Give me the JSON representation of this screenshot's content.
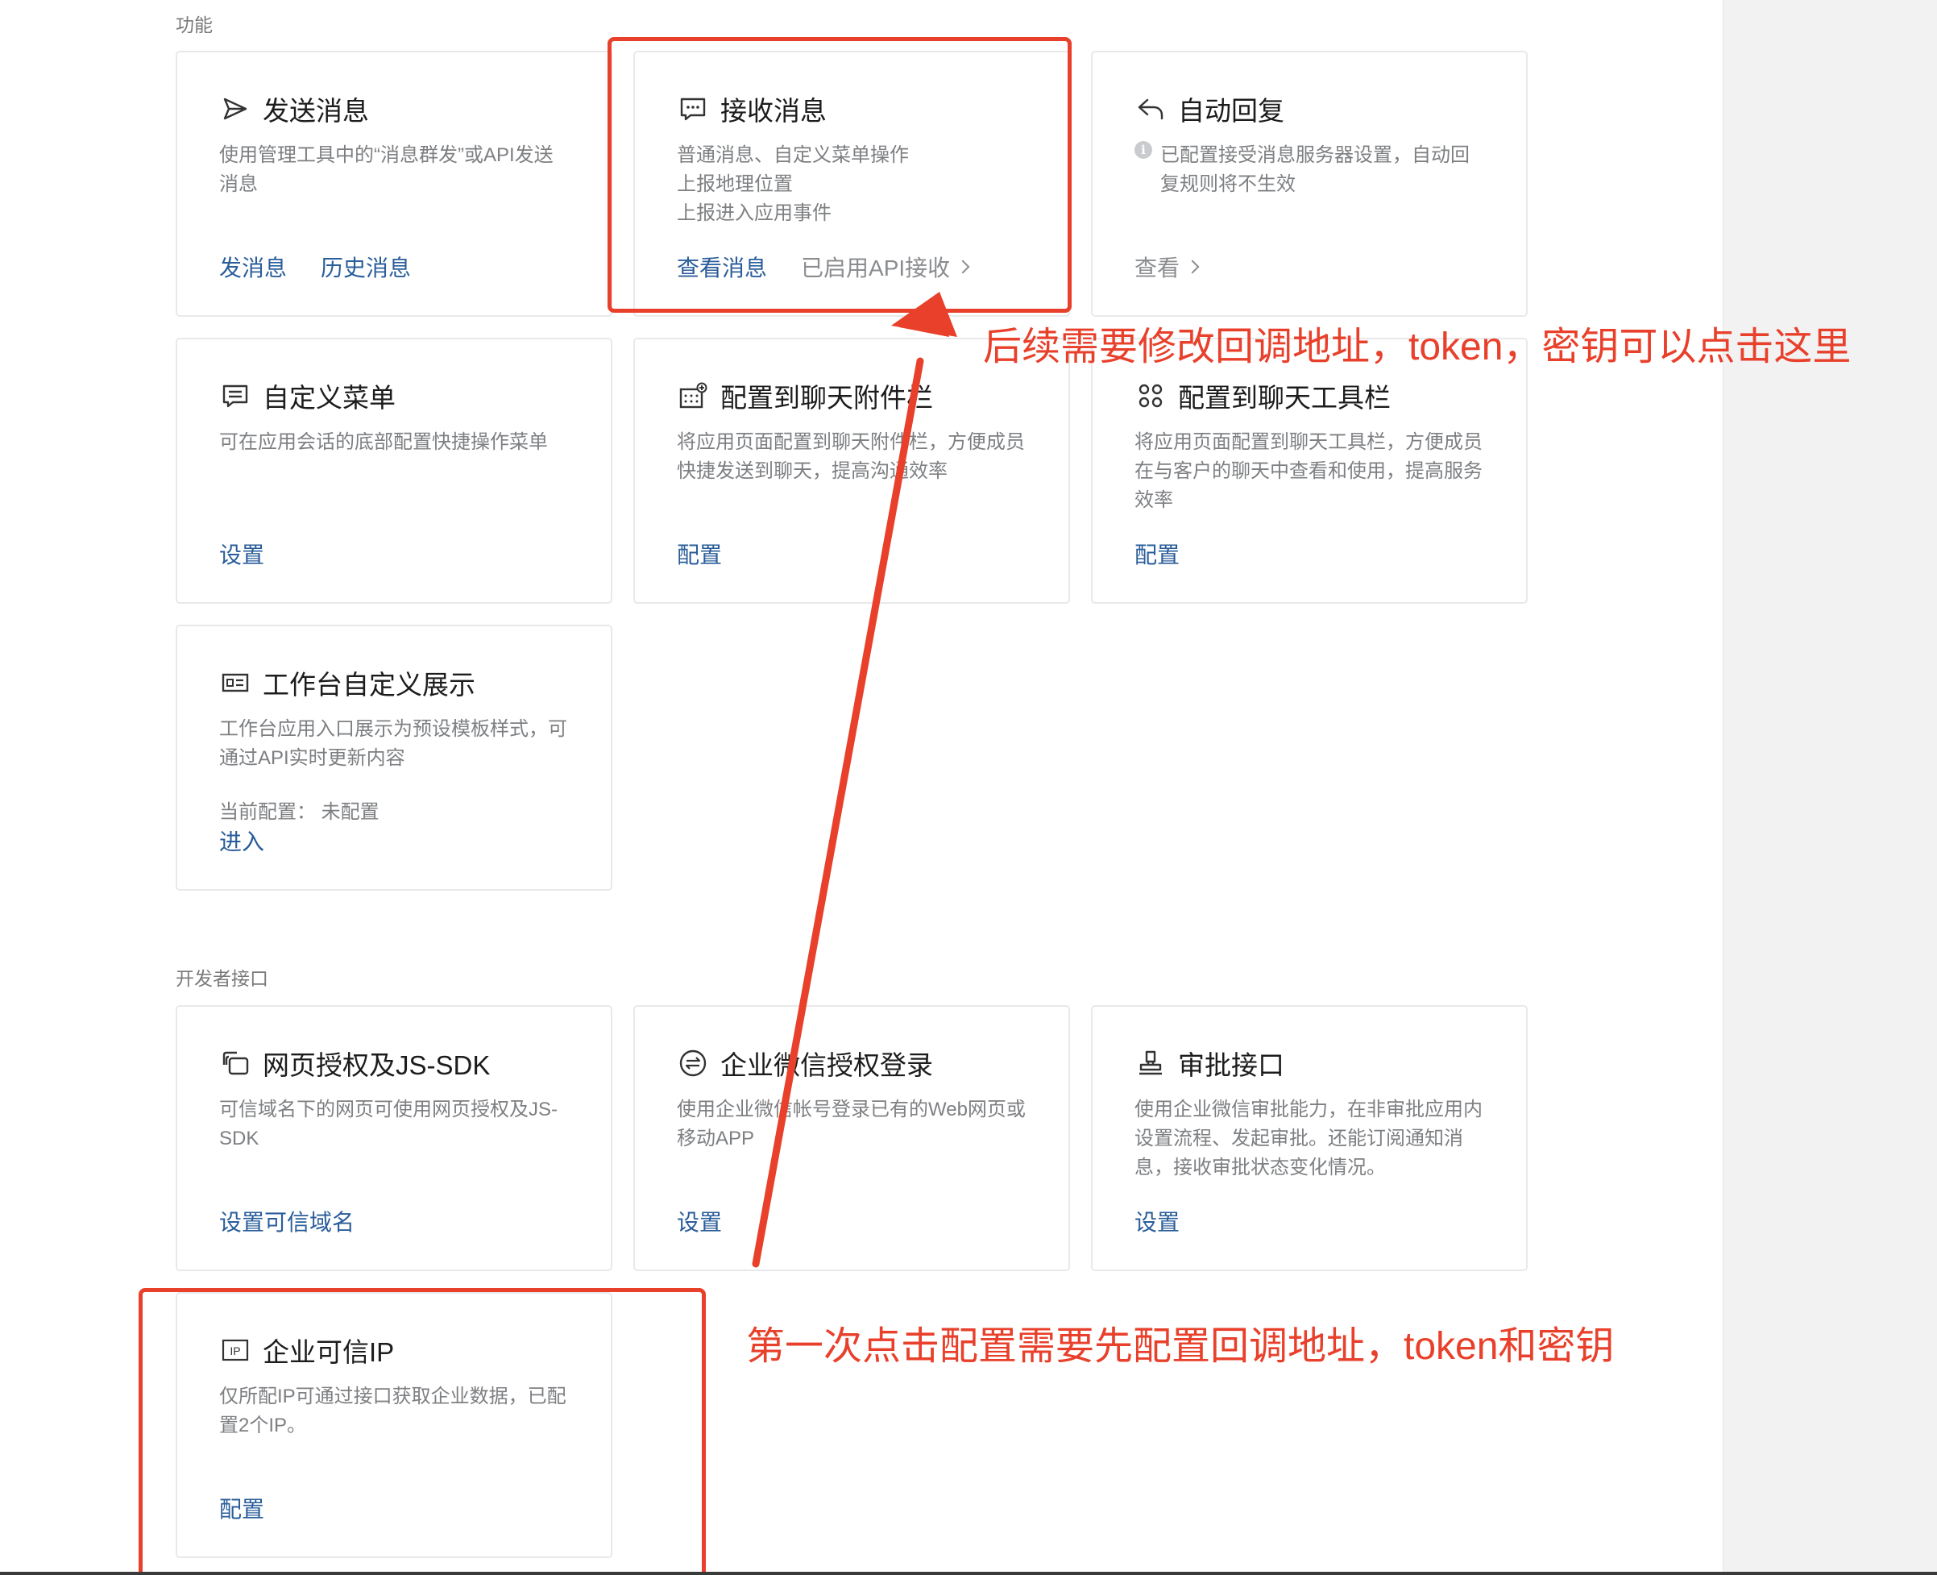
{
  "sections": {
    "features_label": "功能",
    "developer_label": "开发者接口"
  },
  "cards": {
    "send": {
      "icon": "send-icon",
      "title": "发送消息",
      "desc": [
        "使用管理工具中的“消息群发”或API发送",
        "消息"
      ],
      "actions": [
        "发消息",
        "历史消息"
      ]
    },
    "receive": {
      "icon": "message-bubble-icon",
      "title": "接收消息",
      "desc": [
        "普通消息、自定义菜单操作",
        "上报地理位置",
        "上报进入应用事件"
      ],
      "actions": [
        "查看消息"
      ],
      "status": "已启用API接收"
    },
    "autoreply": {
      "icon": "reply-icon",
      "title": "自动回复",
      "notice_icon": "info-icon",
      "desc": "已配置接受消息服务器设置，自动回复规则将不生效",
      "actions": [
        "查看"
      ]
    },
    "menu": {
      "icon": "menu-icon",
      "title": "自定义菜单",
      "desc": [
        "可在应用会话的底部配置快捷操作菜单"
      ],
      "actions": [
        "设置"
      ]
    },
    "attach": {
      "icon": "chat-attachment-icon",
      "title": "配置到聊天附件栏",
      "desc": [
        "将应用页面配置到聊天附件栏，方便成员",
        "快捷发送到聊天，提高沟通效率"
      ],
      "actions": [
        "配置"
      ]
    },
    "toolbar": {
      "icon": "toolbar-icon",
      "title": "配置到聊天工具栏",
      "desc": [
        "将应用页面配置到聊天工具栏，方便成员",
        "在与客户的聊天中查看和使用，提高服务",
        "效率"
      ],
      "actions": [
        "配置"
      ]
    },
    "workbench": {
      "icon": "workbench-icon",
      "title": "工作台自定义展示",
      "desc": [
        "工作台应用入口展示为预设模板样式，可",
        "通过API实时更新内容"
      ],
      "config_state": "当前配置：  未配置",
      "actions": [
        "进入"
      ]
    },
    "webauth": {
      "icon": "web-auth-icon",
      "title": "网页授权及JS-SDK",
      "desc": [
        "可信域名下的网页可使用网页授权及JS-",
        "SDK"
      ],
      "actions": [
        "设置可信域名"
      ]
    },
    "wxlogin": {
      "icon": "switch-icon",
      "title": "企业微信授权登录",
      "desc": [
        "使用企业微信帐号登录已有的Web网页或",
        "移动APP"
      ],
      "actions": [
        "设置"
      ]
    },
    "approval": {
      "icon": "stamp-icon",
      "title": "审批接口",
      "desc": [
        "使用企业微信审批能力，在非审批应用内",
        "设置流程、发起审批。还能订阅通知消",
        "息，接收审批状态变化情况。"
      ],
      "actions": [
        "设置"
      ]
    },
    "trustedip": {
      "icon": "ip-icon",
      "title": "企业可信IP",
      "desc": [
        "仅所配IP可通过接口获取企业数据，已配",
        "置2个IP。"
      ],
      "actions": [
        "配置"
      ]
    }
  },
  "annotations": {
    "top": "后续需要修改回调地址，token，密钥可以点击这里",
    "bottom": "第一次点击配置需要先配置回调地址，token和密钥"
  },
  "colors": {
    "link": "#2a5d9a",
    "annotation": "#e8402b",
    "muted": "#7d7f82"
  }
}
